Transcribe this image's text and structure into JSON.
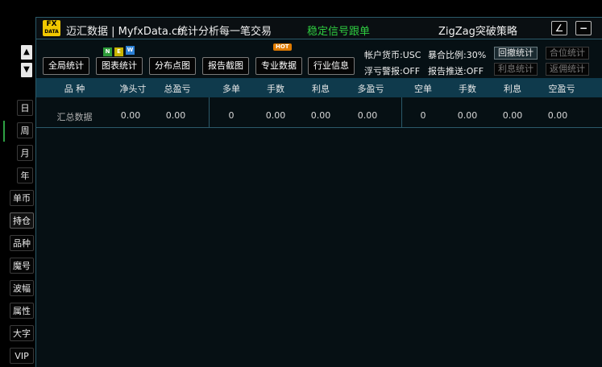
{
  "sidebar": {
    "up_arrow": "▲",
    "down_arrow": "▼",
    "buttons": [
      "日",
      "周",
      "月",
      "年",
      "单币",
      "持仓",
      "品种",
      "魔号",
      "波幅",
      "属性",
      "大字",
      "VIP"
    ],
    "active": "持仓"
  },
  "header": {
    "logo_top": "FX",
    "logo_bottom": "DATA",
    "title": "迈汇数据 | MyfxData.cn",
    "slogan": "统计分析每一笔交易",
    "signal": "稳定信号跟单",
    "strategy": "ZigZag突破策略",
    "resize_glyph": "∠",
    "minimize_glyph": "−"
  },
  "toolbar": {
    "buttons": [
      "全局统计",
      "图表统计",
      "分布点图",
      "报告截图",
      "专业数据",
      "行业信息"
    ],
    "new_badges": [
      "N",
      "E",
      "W"
    ],
    "hot_badge": "HOT",
    "account_currency": "帐户货币:USC",
    "margin_ratio": "暴合比例:30%",
    "float_alert": "浮亏警报:OFF",
    "report_push": "报告推送:OFF",
    "right_buttons": [
      "回撤统计",
      "合位统计",
      "利息统计",
      "返佣统计"
    ]
  },
  "table": {
    "headers": [
      "品 种",
      "净头寸",
      "总盈亏",
      "多单",
      "手数",
      "利息",
      "多盈亏",
      "空单",
      "手数",
      "利息",
      "空盈亏"
    ],
    "rows": [
      [
        "汇总数据",
        "0.00",
        "0.00",
        "0",
        "0.00",
        "0.00",
        "0.00",
        "0",
        "0.00",
        "0.00",
        "0.00"
      ]
    ]
  },
  "colors": {
    "accent": "#2ecc40",
    "table_header_bg": "#0f3a4c",
    "hot": "#e07b00"
  }
}
